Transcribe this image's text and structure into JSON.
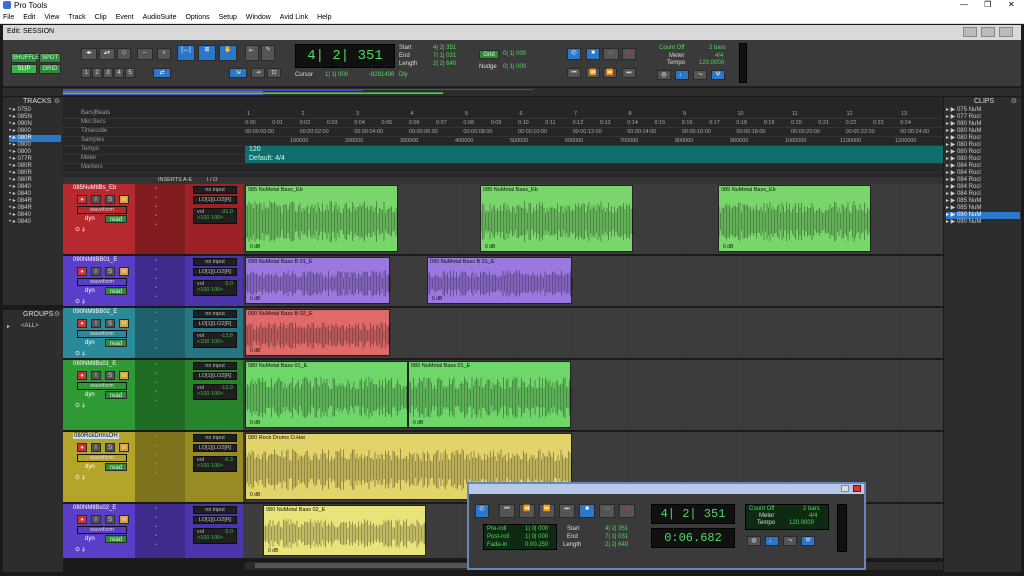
{
  "app": {
    "title": "Pro Tools",
    "window_title": "Edit: SESSION"
  },
  "menu": [
    "File",
    "Edit",
    "View",
    "Track",
    "Clip",
    "Event",
    "AudioSuite",
    "Options",
    "Setup",
    "Window",
    "Avid Link",
    "Help"
  ],
  "toolbar": {
    "modes": [
      "SHUFFLE",
      "SPOT",
      "SLIP",
      "GRID"
    ],
    "zoom_presets": [
      "1",
      "2",
      "3",
      "4",
      "5"
    ],
    "cursor_label": "Cursor",
    "cursor_value": "1| 1| 000",
    "cursor_sample": "-8281496",
    "main_counter": "4| 2| 351",
    "start_label": "Start",
    "end_label": "End",
    "length_label": "Length",
    "start": "4| 2| 351",
    "end": "7| 1| 031",
    "length": "2| 2| 640",
    "grid_label": "Grid",
    "grid_value": "0| 1| 000",
    "nudge_label": "Nudge",
    "nudge_value": "0| 1| 000",
    "count_off": "Count Off",
    "count_bars": "2 bars",
    "meter_label": "Meter",
    "meter_value": "4/4",
    "tempo_label": "Tempo",
    "tempo_value": "120.0000",
    "dly": "Dly"
  },
  "tracks_panel": {
    "title": "TRACKS",
    "items": [
      "0750",
      "085N",
      "090N",
      "0800",
      "080R",
      "0900",
      "0800",
      "077R",
      "080R",
      "080R",
      "080R",
      "0840",
      "0840",
      "084R",
      "084R",
      "0840",
      "0840"
    ],
    "selected_index": 4
  },
  "groups_panel": {
    "title": "GROUPS",
    "item": "<ALL>"
  },
  "clips_panel": {
    "title": "CLIPS",
    "items": [
      "075 NuM",
      "077 Rocl",
      "080 NuM",
      "080 NuM",
      "080 Rocl",
      "080 Rocl",
      "080 Rocl",
      "080 Rocl",
      "084 Rocl",
      "084 Rocl",
      "084 Rocl",
      "084 Rocl",
      "084 Rocl",
      "085 NuM",
      "085 NuM",
      "090 NuM",
      "090 NuM"
    ],
    "selected_index": 15
  },
  "rulers": {
    "bars": "Bars|Beats",
    "min": "Min:Secs",
    "tc": "Timecode",
    "samples": "Samples",
    "tempo": "Tempo",
    "meter": "Meter",
    "markers": "Markers",
    "tempo_value": "120",
    "meter_value": "Default: 4/4",
    "bar_ticks": [
      "1",
      "2",
      "3",
      "4",
      "5",
      "6",
      "7",
      "8",
      "9",
      "10",
      "11",
      "12",
      "13"
    ],
    "min_ticks": [
      "0:00",
      "0:01",
      "0:02",
      "0:03",
      "0:04",
      "0:05",
      "0:06",
      "0:07",
      "0:08",
      "0:09",
      "0:10",
      "0:11",
      "0:12",
      "0:13",
      "0:14",
      "0:15",
      "0:16",
      "0:17",
      "0:18",
      "0:19",
      "0:20",
      "0:21",
      "0:22",
      "0:23",
      "0:24"
    ],
    "tc_ticks": [
      "00:00:00:00",
      "00:00:02:00",
      "00:00:04:00",
      "00:00:06:00",
      "00:00:08:00",
      "00:00:10:00",
      "00:00:12:00",
      "00:00:14:00",
      "00:00:16:00",
      "00:00:18:00",
      "00:00:20:00",
      "00:00:22:00",
      "00:00:24:00"
    ],
    "sample_ticks": [
      "100000",
      "200000",
      "300000",
      "400000",
      "500000",
      "600000",
      "700000",
      "800000",
      "900000",
      "1000000",
      "1100000",
      "1200000"
    ]
  },
  "columns": {
    "inserts": "INSERTS A-E",
    "io": "I / O"
  },
  "tracks": [
    {
      "name": "085NuMtlBs_Eb",
      "color": "#b8282f",
      "view": "waveform",
      "input": "no input",
      "output": "LO[1](LO2[R]",
      "vol": "-31.0",
      "pan": "<100  100>",
      "clips": [
        {
          "name": "085 NuMetal Bass_Eb",
          "db": "0 dB"
        },
        {
          "name": "085 NuMetal Bass_Eb",
          "db": "0 dB"
        },
        {
          "name": "085 NuMetal Bass_Eb",
          "db": "0 dB"
        }
      ]
    },
    {
      "name": "090NMtlBB01_E",
      "color": "#5a3ec8",
      "view": "waveform",
      "input": "no input",
      "output": "LO[1](LO2[R]",
      "vol": "0.0",
      "pan": "<100  100>",
      "clips": [
        {
          "name": "090 NuMetal Bass B 01_E",
          "db": "0 dB"
        },
        {
          "name": "090 NuMetal Bass B 01_E",
          "db": "0 dB"
        }
      ]
    },
    {
      "name": "090NMtlBB02_E",
      "color": "#2b8a9a",
      "view": "waveform",
      "input": "no input",
      "output": "LO[1](LO2[R]",
      "vol": "-13.8",
      "pan": "<100  100>",
      "clips": [
        {
          "name": "090 NuMetal Bass B 02_E",
          "db": "0 dB"
        }
      ]
    },
    {
      "name": "080NMtlBs01_E",
      "color": "#2f9a35",
      "view": "waveform",
      "input": "no input",
      "output": "LO[1](LO2[R]",
      "vol": "-13.9",
      "pan": "<100  100>",
      "clips": [
        {
          "name": "080 NuMetal Bass 01_E",
          "db": "0 dB"
        },
        {
          "name": "080 NuMetal Bass 01_E",
          "db": "0 dB"
        }
      ]
    },
    {
      "name": "080RckDrmsOH",
      "color": "#b3a42a",
      "view": "waveform",
      "input": "no input",
      "output": "LO[1](LO2[R]",
      "vol": "-6.3",
      "pan": "<100  100>",
      "clips": [
        {
          "name": "080 Rock Drums O.Hat",
          "db": "0 dB"
        }
      ]
    },
    {
      "name": "080NMtlBs02_E",
      "color": "#5a3ec8",
      "view": "waveform",
      "input": "no input",
      "output": "LO[1](LO2[R]",
      "vol": "0.0",
      "pan": "<100  100>",
      "clips": [
        {
          "name": "080 NuMetal Bass 02_E",
          "db": "0 dB"
        }
      ]
    }
  ],
  "transport": {
    "counter": "4| 2| 351",
    "sub_counter": "0:06.682",
    "pre_roll": "Pre-roll",
    "post_roll": "Post-roll",
    "fade_in": "Fade-in",
    "pre_val": "1| 0| 000",
    "post_val": "1| 0| 000",
    "fade_val": "0:00.250",
    "start_label": "Start",
    "end_label": "End",
    "length_label": "Length",
    "start": "4| 2| 351",
    "end": "7| 1| 031",
    "length": "2| 2| 640",
    "count_off": "Count Off",
    "count_bars": "2 bars",
    "meter_label": "Meter",
    "meter_value": "4/4",
    "tempo_label": "Tempo",
    "tempo_value": "120.0000"
  },
  "track_buttons": {
    "rec": "●",
    "input": "I",
    "solo": "S",
    "mute": "M",
    "dyn": "dyn",
    "read": "read",
    "vol": "vol"
  }
}
